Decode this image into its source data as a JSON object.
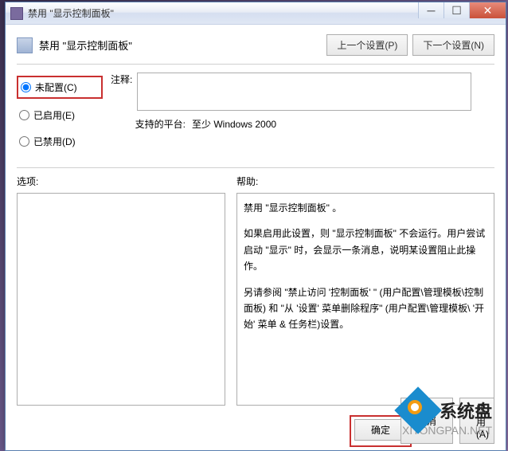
{
  "window": {
    "title": "禁用 \"显示控制面板\""
  },
  "header": {
    "title": "禁用 \"显示控制面板\"",
    "prev_button": "上一个设置(P)",
    "next_button": "下一个设置(N)"
  },
  "radios": {
    "not_configured": "未配置(C)",
    "enabled": "已启用(E)",
    "disabled": "已禁用(D)",
    "selected": "not_configured"
  },
  "comment": {
    "label": "注释:",
    "value": ""
  },
  "platform": {
    "label": "支持的平台:",
    "value": "至少 Windows 2000"
  },
  "sections": {
    "options_label": "选项:",
    "help_label": "帮助:"
  },
  "help": {
    "p1": "禁用 \"显示控制面板\" 。",
    "p2": "如果启用此设置，则 \"显示控制面板\" 不会运行。用户尝试启动 \"显示\" 时，会显示一条消息，说明某设置阻止此操作。",
    "p3": "另请参阅 \"禁止访问 '控制面板' \" (用户配置\\管理模板\\控制面板) 和 \"从 '设置' 菜单删除程序\" (用户配置\\管理模板\\ '开始' 菜单 & 任务栏)设置。"
  },
  "buttons": {
    "ok": "确定",
    "cancel": "取消",
    "apply": "应用(A)"
  },
  "branding": {
    "logo_text": "系统盘",
    "watermark": "XITONGPAN.NET"
  }
}
